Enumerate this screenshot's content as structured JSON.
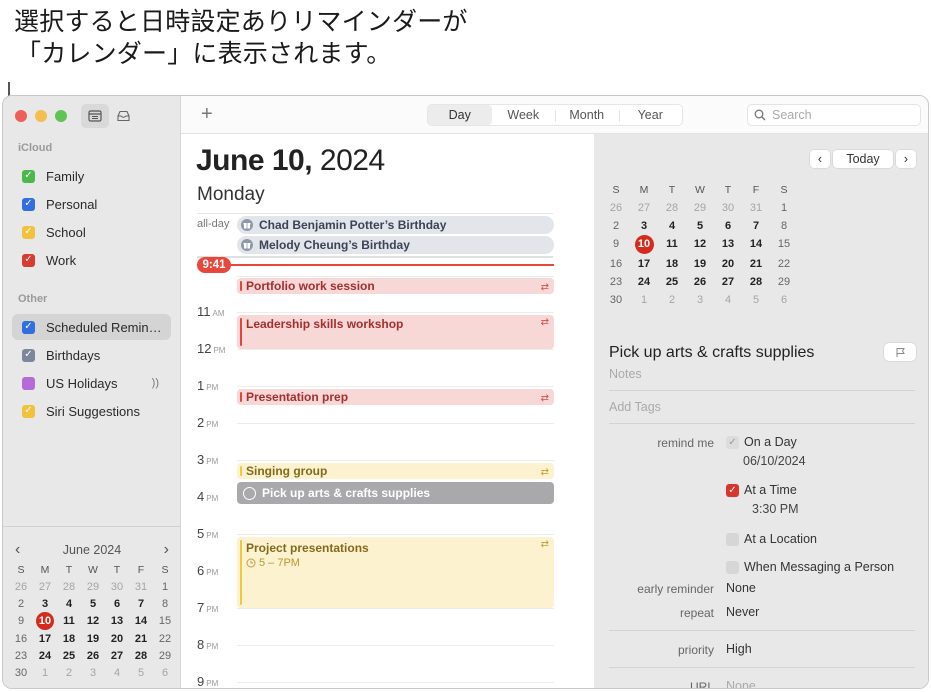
{
  "caption": {
    "line1": "選択すると日時設定ありリマインダーが",
    "line2": "「カレンダー」に表示されます。"
  },
  "sidebar": {
    "sections": [
      {
        "header": "iCloud",
        "items": [
          {
            "label": "Family",
            "color": "#4cb84c",
            "checked": true
          },
          {
            "label": "Personal",
            "color": "#2f6fe0",
            "checked": true
          },
          {
            "label": "School",
            "color": "#f2c23c",
            "checked": true
          },
          {
            "label": "Work",
            "color": "#d93b30",
            "checked": true
          }
        ]
      },
      {
        "header": "Other",
        "items": [
          {
            "label": "Scheduled Remin…",
            "color": "#2f6fe0",
            "checked": true,
            "selected": true
          },
          {
            "label": "Birthdays",
            "color": "#7d869c",
            "checked": true
          },
          {
            "label": "US Holidays",
            "color": "#b66ad8",
            "checked": false,
            "icon": "broadcast-icon",
            "icon_glyph": "))"
          },
          {
            "label": "Siri Suggestions",
            "color": "#f2c23c",
            "checked": true
          }
        ]
      }
    ],
    "mini_calendar": {
      "title": "June 2024",
      "prev": "‹",
      "next": "›",
      "weekdays": [
        "S",
        "M",
        "T",
        "W",
        "T",
        "F",
        "S"
      ],
      "weeks": [
        [
          "26",
          "27",
          "28",
          "29",
          "30",
          "31",
          "1"
        ],
        [
          "2",
          "3",
          "4",
          "5",
          "6",
          "7",
          "8"
        ],
        [
          "9",
          "10",
          "11",
          "12",
          "13",
          "14",
          "15"
        ],
        [
          "16",
          "17",
          "18",
          "19",
          "20",
          "21",
          "22"
        ],
        [
          "23",
          "24",
          "25",
          "26",
          "27",
          "28",
          "29"
        ],
        [
          "30",
          "1",
          "2",
          "3",
          "4",
          "5",
          "6"
        ]
      ],
      "today": "10"
    }
  },
  "toolbar": {
    "add_label": "+",
    "views": [
      "Day",
      "Week",
      "Month",
      "Year"
    ],
    "active_view": "Day",
    "search_placeholder": "Search"
  },
  "day_view": {
    "date_bold": "June 10,",
    "year": " 2024",
    "weekday": "Monday",
    "allday_label": "all-day",
    "allday_events": [
      "Chad Benjamin Potter’s Birthday",
      "Melody Cheung’s Birthday"
    ],
    "current_time": "9:41",
    "hours": [
      {
        "h": "11",
        "p": "AM"
      },
      {
        "h": "12",
        "p": "PM"
      },
      {
        "h": "1",
        "p": "PM"
      },
      {
        "h": "2",
        "p": "PM"
      },
      {
        "h": "3",
        "p": "PM"
      },
      {
        "h": "4",
        "p": "PM"
      },
      {
        "h": "5",
        "p": "PM"
      },
      {
        "h": "6",
        "p": "PM"
      },
      {
        "h": "7",
        "p": "PM"
      },
      {
        "h": "8",
        "p": "PM"
      },
      {
        "h": "9",
        "p": "PM"
      }
    ],
    "events": [
      {
        "title": "Portfolio work session",
        "calendar": "Work",
        "repeat": true
      },
      {
        "title": "Leadership skills workshop",
        "calendar": "Work",
        "repeat": true
      },
      {
        "title": "Presentation prep",
        "calendar": "Work",
        "repeat": true
      },
      {
        "title": "Singing group",
        "calendar": "School",
        "repeat": true
      },
      {
        "title": "Project presentations",
        "calendar": "School",
        "repeat": true,
        "time": "5 – 7PM"
      }
    ],
    "reminder_event": {
      "title": "Pick up arts & crafts supplies"
    },
    "repeat_glyph": "⇄"
  },
  "inspector": {
    "nav": {
      "prev": "‹",
      "today": "Today",
      "next": "›"
    },
    "calendar": {
      "weekdays": [
        "S",
        "M",
        "T",
        "W",
        "T",
        "F",
        "S"
      ],
      "weeks": [
        [
          "26",
          "27",
          "28",
          "29",
          "30",
          "31",
          "1"
        ],
        [
          "2",
          "3",
          "4",
          "5",
          "6",
          "7",
          "8"
        ],
        [
          "9",
          "10",
          "11",
          "12",
          "13",
          "14",
          "15"
        ],
        [
          "16",
          "17",
          "18",
          "19",
          "20",
          "21",
          "22"
        ],
        [
          "23",
          "24",
          "25",
          "26",
          "27",
          "28",
          "29"
        ],
        [
          "30",
          "1",
          "2",
          "3",
          "4",
          "5",
          "6"
        ]
      ],
      "today": "10"
    },
    "reminder": {
      "title": "Pick up arts & crafts supplies",
      "notes_placeholder": "Notes",
      "tags_placeholder": "Add Tags",
      "remind_me_label": "remind me",
      "on_a_day": {
        "label": "On a Day",
        "checked": true,
        "value": "06/10/2024"
      },
      "at_a_time": {
        "label": "At a Time",
        "checked": true,
        "value": "3:30 PM"
      },
      "at_a_location": {
        "label": "At a Location",
        "checked": false
      },
      "when_messaging": {
        "label": "When Messaging a Person",
        "checked": false
      },
      "early_reminder_label": "early reminder",
      "early_reminder_value": "None",
      "repeat_label": "repeat",
      "repeat_value": "Never",
      "priority_label": "priority",
      "priority_value": "High",
      "url_label": "URL",
      "url_value": "None"
    }
  }
}
